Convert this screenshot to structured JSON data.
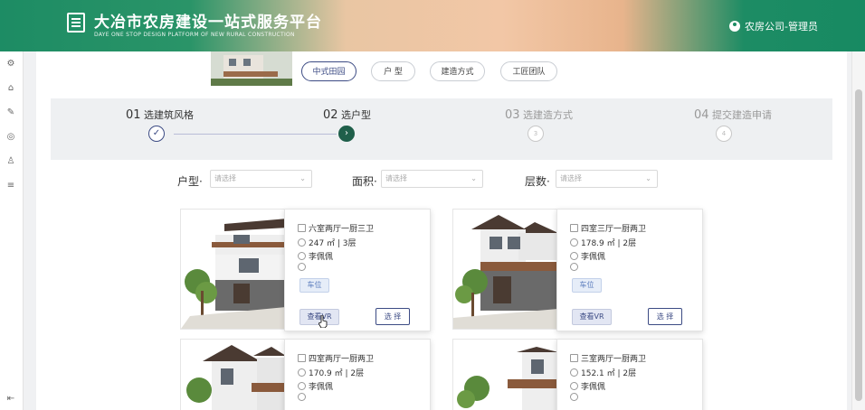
{
  "header": {
    "title": "大冶市农房建设一站式服务平台",
    "subtitle": "DAYE ONE STOP DESIGN PLATFORM OF NEW RURAL CONSTRUCTION",
    "user": "农房公司-管理员"
  },
  "tabs": [
    "中式田园",
    "户 型",
    "建造方式",
    "工匠团队"
  ],
  "steps": [
    {
      "num": "01",
      "label": "选建筑风格",
      "state": "done"
    },
    {
      "num": "02",
      "label": "选户型",
      "state": "active"
    },
    {
      "num": "03",
      "label": "选建造方式",
      "state": "pending",
      "circle": "3"
    },
    {
      "num": "04",
      "label": "提交建造申请",
      "state": "pending",
      "circle": "4"
    }
  ],
  "step_marks": {
    "done": "✓",
    "active": "›"
  },
  "filters": [
    {
      "label": "户型",
      "placeholder": "请选择"
    },
    {
      "label": "面积",
      "placeholder": "请选择"
    },
    {
      "label": "层数",
      "placeholder": "请选择"
    }
  ],
  "cards": [
    {
      "layout": "六室两厅一厨三卫",
      "area": "247 ㎡ | 3层",
      "designer": "李佩佩",
      "tag": "车位",
      "vr": "查看VR",
      "choose": "选 择"
    },
    {
      "layout": "四室三厅一厨两卫",
      "area": "178.9 ㎡ | 2层",
      "designer": "李佩佩",
      "tag": "车位",
      "vr": "查看VR",
      "choose": "选 择"
    },
    {
      "layout": "四室两厅一厨两卫",
      "area": "170.9 ㎡ | 2层",
      "designer": "李佩佩"
    },
    {
      "layout": "三室两厅一厨两卫",
      "area": "152.1 ㎡ | 2层",
      "designer": "李佩佩"
    }
  ],
  "colors": {
    "brand_green": "#1d8c64",
    "accent": "#3c4b84"
  }
}
